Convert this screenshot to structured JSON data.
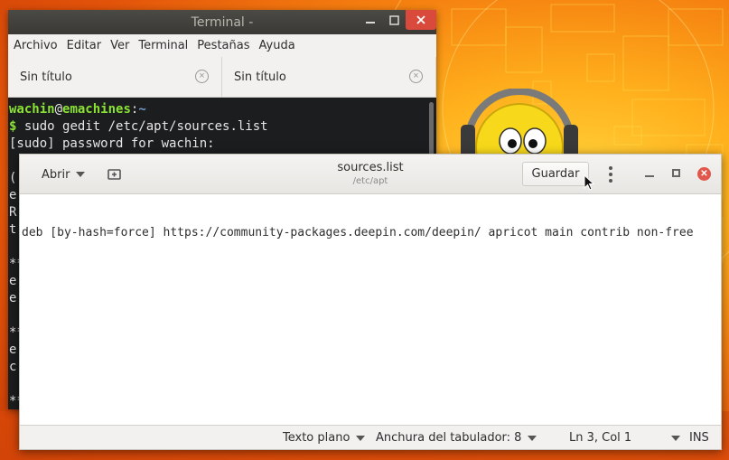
{
  "terminal": {
    "title": "Terminal -",
    "menu": [
      "Archivo",
      "Editar",
      "Ver",
      "Terminal",
      "Pestañas",
      "Ayuda"
    ],
    "tabs": [
      {
        "label": "Sin título"
      },
      {
        "label": "Sin título"
      }
    ],
    "lines": {
      "prompt_user": "wachin",
      "prompt_at": "@",
      "prompt_host": "emachines",
      "prompt_colon": ":",
      "prompt_path": "~",
      "prompt_dollar": "$",
      "command": " sudo gedit /etc/apt/sources.list",
      "sudo": "[sudo] password for wachin:",
      "fragments": [
        "(",
        "e",
        "R",
        "t",
        "**",
        "e",
        "e",
        "**",
        "e",
        "c",
        "**"
      ]
    }
  },
  "gedit": {
    "open_label": "Abrir",
    "title": "sources.list",
    "subtitle": "/etc/apt",
    "save_label": "Guardar",
    "content_line": "deb [by-hash=force] https://community-packages.deepin.com/deepin/ apricot main contrib non-free",
    "status": {
      "language": "Texto plano",
      "tab_width": "Anchura del tabulador: 8",
      "position": "Ln 3, Col 1",
      "mode": "INS"
    }
  },
  "colors": {
    "terminal_bg": "#1b1d1e",
    "prompt_user": "#8ae234",
    "prompt_path": "#729fcf",
    "close_button": "#d94a3c",
    "gedit_close": "#e2574c"
  }
}
